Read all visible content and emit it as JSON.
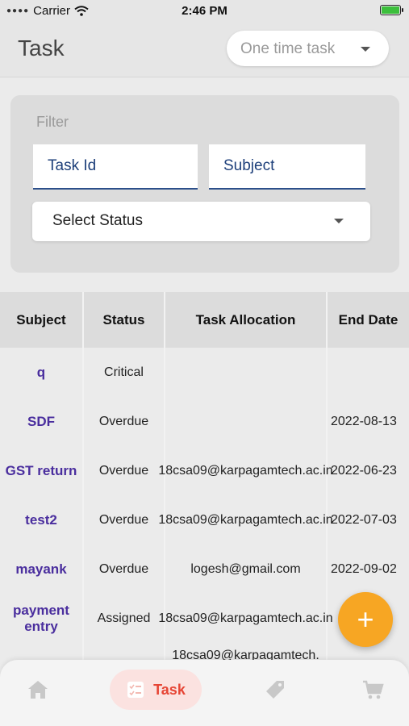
{
  "status_bar": {
    "carrier": "Carrier",
    "time": "2:46 PM"
  },
  "app_bar": {
    "title": "Task",
    "task_type": "One time task"
  },
  "filter": {
    "label": "Filter",
    "task_id_label": "Task Id",
    "subject_label": "Subject",
    "status_placeholder": "Select Status"
  },
  "table": {
    "headers": [
      "Subject",
      "Status",
      "Task Allocation",
      "End Date"
    ],
    "rows": [
      {
        "subject": "q",
        "status": "Critical",
        "allocation": "",
        "end_date": ""
      },
      {
        "subject": "SDF",
        "status": "Overdue",
        "allocation": "",
        "end_date": "2022-08-13"
      },
      {
        "subject": "GST return",
        "status": "Overdue",
        "allocation": "18csa09@karpagamtech.ac.in",
        "end_date": "2022-06-23"
      },
      {
        "subject": "test2",
        "status": "Overdue",
        "allocation": "18csa09@karpagamtech.ac.in",
        "end_date": "2022-07-03"
      },
      {
        "subject": "mayank",
        "status": "Overdue",
        "allocation": "logesh@gmail.com",
        "end_date": "2022-09-02"
      },
      {
        "subject": "payment entry",
        "status": "Assigned",
        "allocation": "18csa09@karpagamtech.ac.in",
        "end_date": ""
      },
      {
        "subject": "",
        "status": "",
        "allocation": "18csa09@karpagamtech.",
        "end_date": ""
      }
    ]
  },
  "fab": {
    "icon": "plus-icon"
  },
  "bottom_nav": {
    "items": [
      {
        "icon": "home-icon"
      },
      {
        "icon": "task-icon",
        "label": "Task",
        "active": true
      },
      {
        "icon": "tag-icon"
      },
      {
        "icon": "cart-icon"
      }
    ]
  },
  "colors": {
    "accent": "#f7a623",
    "active_nav": "#e64535",
    "subject_link": "#4a2e9e",
    "field_underline": "#2c4f8a"
  }
}
